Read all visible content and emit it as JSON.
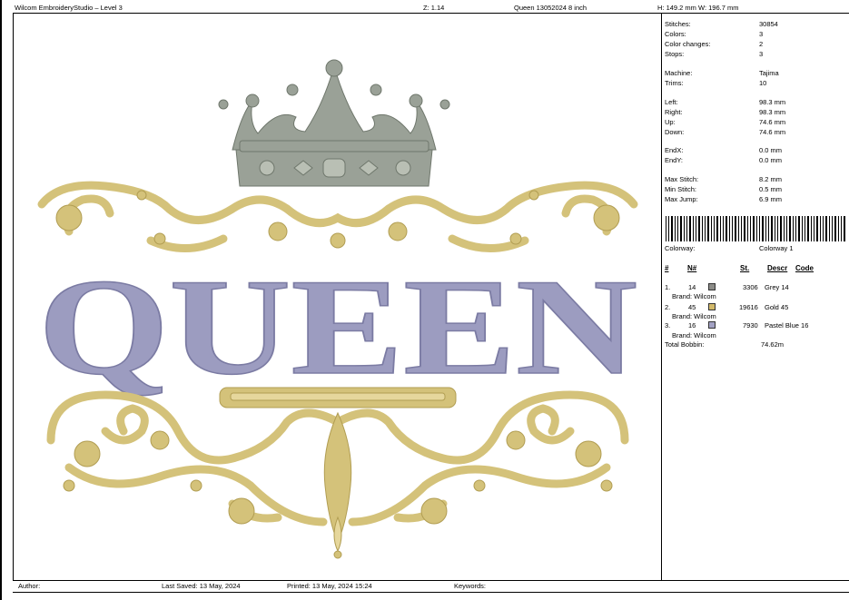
{
  "header": {
    "title": "Wilcom EmbroideryStudio – Level 3",
    "zoom": "Z: 1.14",
    "file": "Queen 13052024 8  inch",
    "size": "H: 149.2 mm   W: 196.7 mm"
  },
  "stats": [
    {
      "k": "Stitches:",
      "v": "30854"
    },
    {
      "k": "Colors:",
      "v": "3"
    },
    {
      "k": "Color changes:",
      "v": "2"
    },
    {
      "k": "Stops:",
      "v": "3"
    },
    {
      "k": "Machine:",
      "v": "Tajima"
    },
    {
      "k": "Trims:",
      "v": "10"
    },
    {
      "k": "Left:",
      "v": "98.3 mm"
    },
    {
      "k": "Right:",
      "v": "98.3 mm"
    },
    {
      "k": "Up:",
      "v": "74.6 mm"
    },
    {
      "k": "Down:",
      "v": "74.6 mm"
    },
    {
      "k": "EndX:",
      "v": "0.0 mm"
    },
    {
      "k": "EndY:",
      "v": "0.0 mm"
    },
    {
      "k": "Max Stitch:",
      "v": "8.2 mm"
    },
    {
      "k": "Min Stitch:",
      "v": "0.5 mm"
    },
    {
      "k": "Max Jump:",
      "v": "6.9 mm"
    }
  ],
  "colorway": {
    "label": "Colorway:",
    "value": "Colorway 1"
  },
  "table_headers": {
    "num": "#",
    "n": "N#",
    "st": "St.",
    "descr": "Descr",
    "code": "Code"
  },
  "threads": [
    {
      "idx": "1.",
      "n": "14",
      "color": "#8c8c88",
      "st": "3306",
      "descr": "Grey 14",
      "brand": "Brand: Wilcom"
    },
    {
      "idx": "2.",
      "n": "45",
      "color": "#d2b96a",
      "st": "19616",
      "descr": "Gold 45",
      "brand": "Brand: Wilcom"
    },
    {
      "idx": "3.",
      "n": "16",
      "color": "#a3a2c4",
      "st": "7930",
      "descr": "Pastel Blue 16",
      "brand": "Brand: Wilcom"
    }
  ],
  "total_bobbin": {
    "label": "Total Bobbin:",
    "value": "74.62m"
  },
  "design": {
    "word": "QUEEN",
    "colors": {
      "grey": "#9aa197",
      "gold": "#d4c27a",
      "blue": "#9c9cc0"
    }
  },
  "footer": {
    "author": "Author:",
    "last_saved": "Last Saved: 13 May, 2024",
    "printed": "Printed:  13 May, 2024 15:24",
    "keywords": "Keywords:"
  }
}
